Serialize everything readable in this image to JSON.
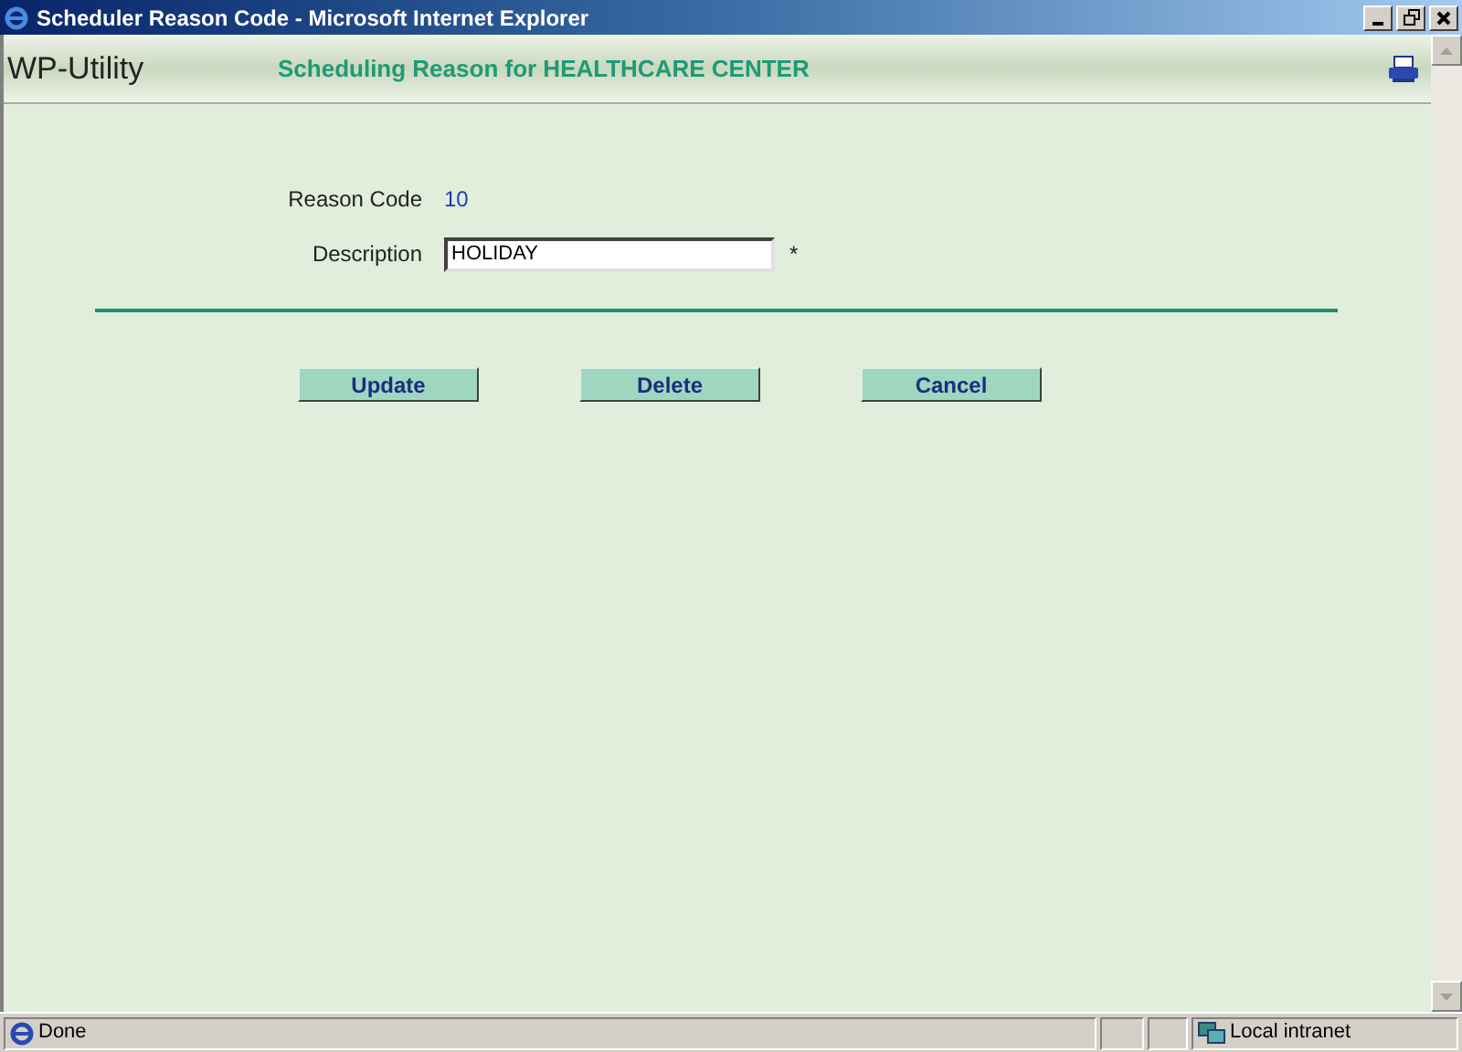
{
  "window": {
    "title": "Scheduler Reason Code - Microsoft Internet Explorer"
  },
  "header": {
    "logo": "WP-Utility",
    "title": "Scheduling Reason for HEALTHCARE CENTER"
  },
  "fields": [
    {
      "kind": "text",
      "label": "Reason Code",
      "value": "10"
    },
    {
      "kind": "input",
      "label": "Description",
      "value": "HOLIDAY",
      "mark": "*"
    }
  ],
  "buttons": [
    "Update",
    "Delete",
    "Cancel"
  ],
  "status_bar": {
    "text": "Done",
    "zone": "Local intranet"
  }
}
